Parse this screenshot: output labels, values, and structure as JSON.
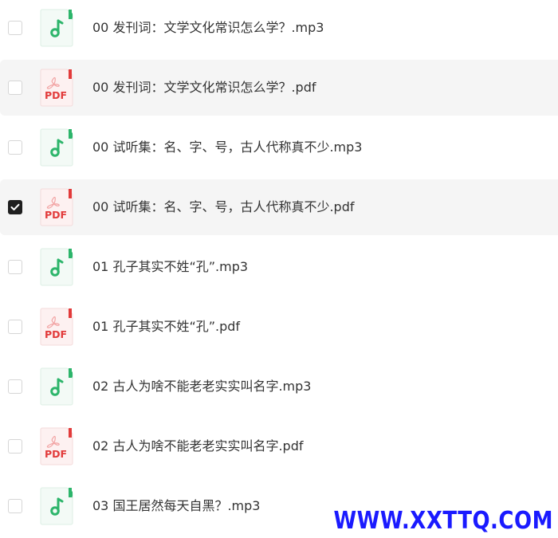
{
  "colors": {
    "audio_accent": "#2db56b",
    "pdf_accent": "#e23b3b",
    "checked": "#1f1f1f",
    "row_hover_bg": "#f5f5f5",
    "watermark": "#1a1aff"
  },
  "files": [
    {
      "name": "00 发刊词：文学文化常识怎么学？.mp3",
      "type": "audio",
      "icon": "music-note-icon",
      "checked": false,
      "hover": false
    },
    {
      "name": "00 发刊词：文学文化常识怎么学？.pdf",
      "type": "pdf",
      "icon": "pdf-icon",
      "icon_label": "PDF",
      "checked": false,
      "hover": true
    },
    {
      "name": "00 试听集：名、字、号，古人代称真不少.mp3",
      "type": "audio",
      "icon": "music-note-icon",
      "checked": false,
      "hover": false
    },
    {
      "name": "00 试听集：名、字、号，古人代称真不少.pdf",
      "type": "pdf",
      "icon": "pdf-icon",
      "icon_label": "PDF",
      "checked": true,
      "hover": true
    },
    {
      "name": "01 孔子其实不姓“孔”.mp3",
      "type": "audio",
      "icon": "music-note-icon",
      "checked": false,
      "hover": false
    },
    {
      "name": "01 孔子其实不姓“孔”.pdf",
      "type": "pdf",
      "icon": "pdf-icon",
      "icon_label": "PDF",
      "checked": false,
      "hover": false
    },
    {
      "name": "02 古人为啥不能老老实实叫名字.mp3",
      "type": "audio",
      "icon": "music-note-icon",
      "checked": false,
      "hover": false
    },
    {
      "name": "02 古人为啥不能老老实实叫名字.pdf",
      "type": "pdf",
      "icon": "pdf-icon",
      "icon_label": "PDF",
      "checked": false,
      "hover": false
    },
    {
      "name": "03 国王居然每天自黑？.mp3",
      "type": "audio",
      "icon": "music-note-icon",
      "checked": false,
      "hover": false
    }
  ],
  "watermark": "WWW.XXTTQ.COM"
}
